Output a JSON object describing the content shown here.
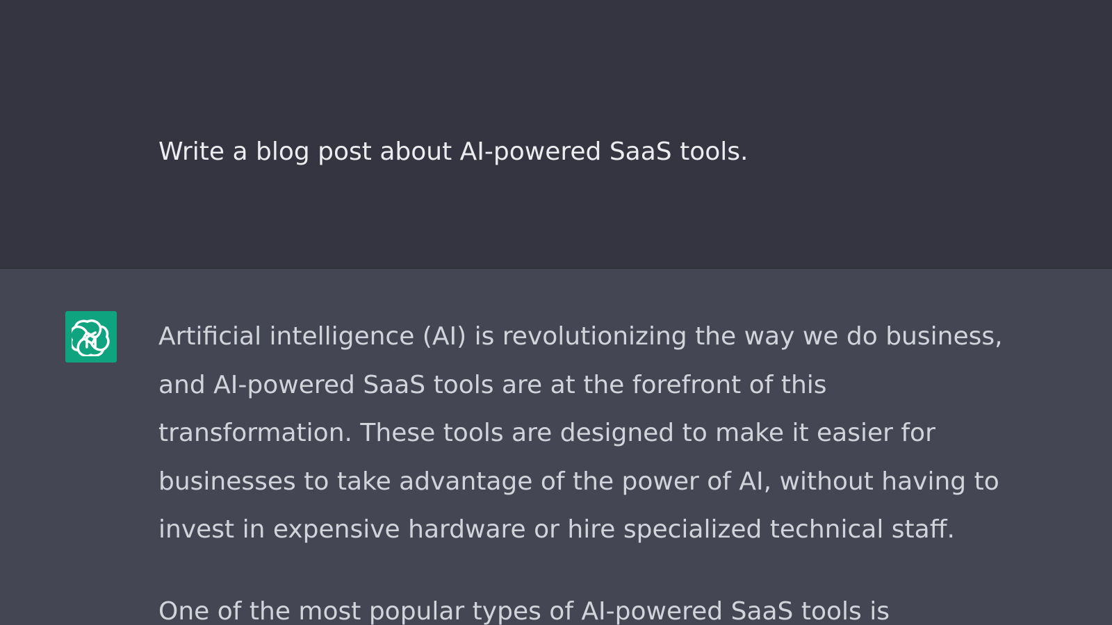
{
  "conversation": {
    "user_message": {
      "text": "Write a blog post about AI-powered SaaS tools."
    },
    "assistant_message": {
      "avatar_icon": "openai-logo-icon",
      "paragraphs": [
        {
          "lines": [
            "Artificial intelligence (AI) is revolutionizing the way we do business,",
            "and AI-powered SaaS tools are at the forefront of this",
            "transformation. These tools are designed to make it easier for",
            "businesses to take advantage of the power of AI, without having to",
            "invest in expensive hardware or hire specialized technical staff."
          ]
        },
        {
          "lines": [
            "One of the most popular types of AI-powered SaaS tools is"
          ]
        }
      ]
    }
  },
  "colors": {
    "user_background": "#343541",
    "assistant_background": "#444654",
    "avatar_background": "#10a37f",
    "user_text": "#ececf1",
    "assistant_text": "#d1d5db"
  }
}
